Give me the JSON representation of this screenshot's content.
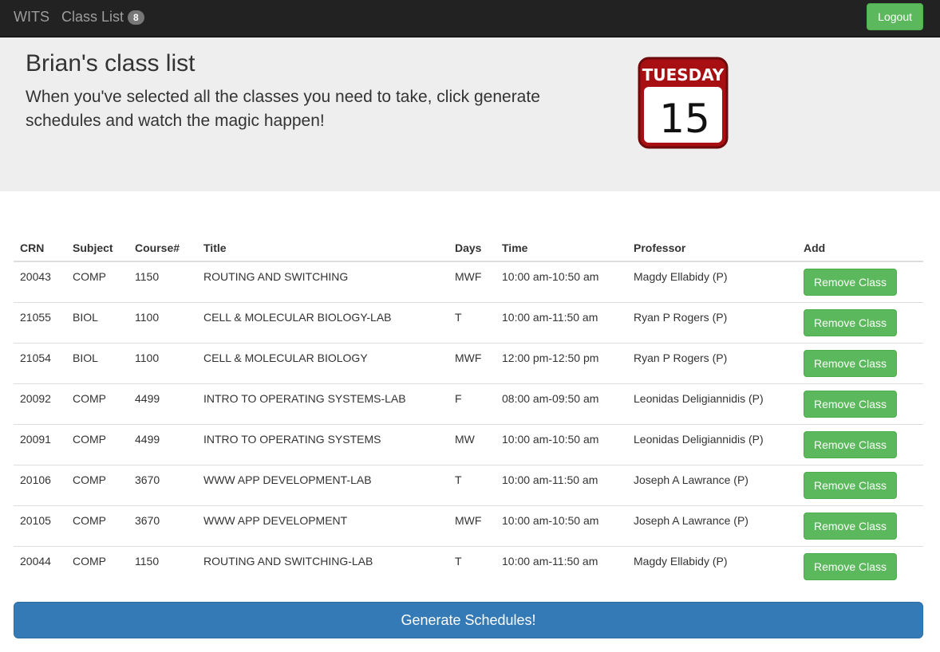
{
  "navbar": {
    "brand": "WITS",
    "class_list_label": "Class List",
    "class_count": "8",
    "logout_label": "Logout"
  },
  "jumbotron": {
    "title": "Brian's class list",
    "subtitle": "When you've selected all the classes you need to take, click generate schedules and watch the magic happen!",
    "calendar_day": "TUESDAY",
    "calendar_date": "15",
    "calendar_color": "#a80f13"
  },
  "table": {
    "columns": [
      "CRN",
      "Subject",
      "Course#",
      "Title",
      "Days",
      "Time",
      "Professor",
      "Add"
    ],
    "rows": [
      {
        "crn": "20043",
        "subject": "COMP",
        "course": "1150",
        "title": "ROUTING AND SWITCHING",
        "days": "MWF",
        "time": "10:00 am-10:50 am",
        "professor": "Magdy Ellabidy (P)",
        "action": "Remove Class"
      },
      {
        "crn": "21055",
        "subject": "BIOL",
        "course": "1100",
        "title": "CELL & MOLECULAR BIOLOGY-LAB",
        "days": "T",
        "time": "10:00 am-11:50 am",
        "professor": "Ryan P Rogers (P)",
        "action": "Remove Class"
      },
      {
        "crn": "21054",
        "subject": "BIOL",
        "course": "1100",
        "title": "CELL & MOLECULAR BIOLOGY",
        "days": "MWF",
        "time": "12:00 pm-12:50 pm",
        "professor": "Ryan P Rogers (P)",
        "action": "Remove Class"
      },
      {
        "crn": "20092",
        "subject": "COMP",
        "course": "4499",
        "title": "INTRO TO OPERATING SYSTEMS-LAB",
        "days": "F",
        "time": "08:00 am-09:50 am",
        "professor": "Leonidas Deligiannidis (P)",
        "action": "Remove Class"
      },
      {
        "crn": "20091",
        "subject": "COMP",
        "course": "4499",
        "title": "INTRO TO OPERATING SYSTEMS",
        "days": "MW",
        "time": "10:00 am-10:50 am",
        "professor": "Leonidas Deligiannidis (P)",
        "action": "Remove Class"
      },
      {
        "crn": "20106",
        "subject": "COMP",
        "course": "3670",
        "title": "WWW APP DEVELOPMENT-LAB",
        "days": "T",
        "time": "10:00 am-11:50 am",
        "professor": "Joseph A Lawrance (P)",
        "action": "Remove Class"
      },
      {
        "crn": "20105",
        "subject": "COMP",
        "course": "3670",
        "title": "WWW APP DEVELOPMENT",
        "days": "MWF",
        "time": "10:00 am-10:50 am",
        "professor": "Joseph A Lawrance (P)",
        "action": "Remove Class"
      },
      {
        "crn": "20044",
        "subject": "COMP",
        "course": "1150",
        "title": "ROUTING AND SWITCHING-LAB",
        "days": "T",
        "time": "10:00 am-11:50 am",
        "professor": "Magdy Ellabidy (P)",
        "action": "Remove Class"
      }
    ]
  },
  "generate_label": "Generate Schedules!",
  "colors": {
    "navbar_bg": "#222222",
    "success": "#5cb85c",
    "primary": "#337ab7",
    "jumbotron_bg": "#eeeeee"
  }
}
